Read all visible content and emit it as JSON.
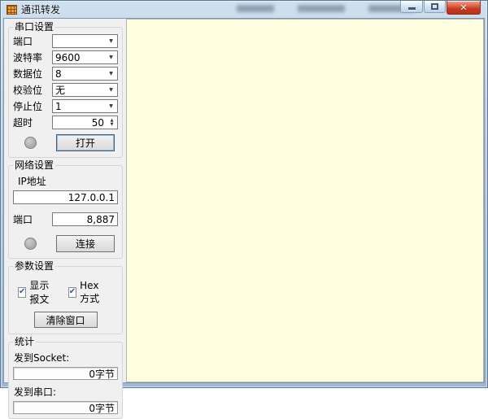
{
  "window": {
    "title": "通讯转发"
  },
  "icons": {
    "dropdown": "▼",
    "spin_up": "▲",
    "spin_down": "▼",
    "check": "✔",
    "close": "✕"
  },
  "serial": {
    "title": "串口设置",
    "rows": [
      {
        "label": "端口",
        "value": ""
      },
      {
        "label": "波特率",
        "value": "9600"
      },
      {
        "label": "数据位",
        "value": "8"
      },
      {
        "label": "校验位",
        "value": "无"
      },
      {
        "label": "停止位",
        "value": "1"
      }
    ],
    "timeout": {
      "label": "超时",
      "value": "50"
    },
    "open_button": "打开"
  },
  "network": {
    "title": "网络设置",
    "ip": {
      "label": "IP地址",
      "value": "127.0.0.1"
    },
    "port": {
      "label": "端口",
      "value": "8,887"
    },
    "connect_button": "连接"
  },
  "params": {
    "title": "参数设置",
    "checkboxes": [
      {
        "label": "显示报文",
        "checked": true
      },
      {
        "label": "Hex方式",
        "checked": true
      }
    ],
    "clear_button": "清除窗口"
  },
  "stats": {
    "title": "统计",
    "sent_socket": {
      "label": "发到Socket:",
      "value": "0字节"
    },
    "sent_serial": {
      "label": "发到串口:",
      "value": "0字节"
    }
  },
  "colors": {
    "log_background": "#ffffe1",
    "titlebar": "#b3cbe3",
    "close_button": "#c83a20",
    "panel_background": "#f0f0f0"
  }
}
